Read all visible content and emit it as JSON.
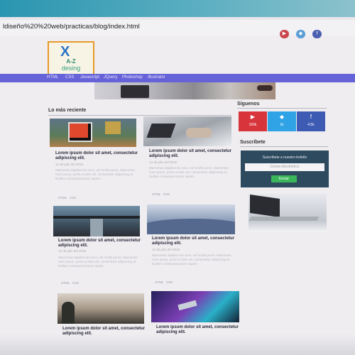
{
  "browser": {
    "url": "ldiseño%20%20web/practicas/blog/index.html"
  },
  "logo": {
    "letter": "X",
    "line1": "A-Z",
    "line2": "desing"
  },
  "top_social": [
    {
      "icon": "youtube-icon",
      "glyph": "▶"
    },
    {
      "icon": "twitter-icon",
      "glyph": "◆"
    },
    {
      "icon": "facebook-icon",
      "glyph": "f"
    }
  ],
  "nav": {
    "items": [
      "HTML",
      "CSS",
      "Javascript",
      "JQuery",
      "Photoshop",
      "Illustrator"
    ]
  },
  "main": {
    "title": "Lo más reciente",
    "posts": [
      {
        "title": "Lorem ipsum dolor sit amet, consectetur adipiscing elit.",
        "date": "12 de julio del 2018",
        "excerpt": "Maecenas dapibus leo arcu, vel mollis purus. Maecenas nunc purus, porta ut ante vel, consectetur adipiscing at Nullam consequat ipsum sapien.",
        "tags": [
          "HTML",
          "CSS"
        ]
      },
      {
        "title": "Lorem ipsum dolor sit amet, consectetur adipiscing elit.",
        "date": "12 de julio del 2018",
        "excerpt": "Maecenas dapibus leo arcu, vel mollis purus. Maecenas nunc purus, porta ut ante vel, consectetur adipiscing at Nullam consequat ipsum sapien.",
        "tags": [
          "HTML",
          "CSS"
        ]
      },
      {
        "title": "Lorem ipsum dolor sit amet, consectetur adipiscing elit.",
        "date": "12 de julio del 2018",
        "excerpt": "Maecenas dapibus leo arcu, vel mollis purus. Maecenas nunc purus, porta ut ante vel, consectetur adipiscing at Nullam consequat ipsum sapien.",
        "tags": [
          "HTML",
          "CSS"
        ]
      },
      {
        "title": "Lorem ipsum dolor sit amet, consectetur adipiscing elit.",
        "date": "12 de julio del 2018",
        "excerpt": "Maecenas dapibus leo arcu, vel mollis purus. Maecenas nunc purus, porta ut ante vel, consectetur adipiscing at Nullam consequat ipsum sapien.",
        "tags": [
          "HTML",
          "CSS"
        ]
      },
      {
        "title": "Lorem ipsum dolor sit amet, consectetur adipiscing elit.",
        "date": "",
        "excerpt": "",
        "tags": []
      },
      {
        "title": "Lorem ipsum dolor sit amet, consectetur adipiscing elit.",
        "date": "",
        "excerpt": "",
        "tags": []
      }
    ]
  },
  "sidebar": {
    "follow_title": "Síguenos",
    "follow": [
      {
        "icon": "youtube-icon",
        "glyph": "▶",
        "count": "150k",
        "color": "#d8343c"
      },
      {
        "icon": "twitter-icon",
        "glyph": "◆",
        "count": "1k",
        "color": "#2fa3e6"
      },
      {
        "icon": "facebook-icon",
        "glyph": "f",
        "count": "4.5k",
        "color": "#3e5bb3"
      }
    ],
    "subscribe_title": "Suscríbete",
    "subscribe": {
      "text": "Suscríbete a nuestro boletín",
      "placeholder": "Correo Electrónico",
      "button": "Enviar"
    }
  },
  "colors": {
    "nav": "#6662d8",
    "subscribe_bg": "#2e4a5e",
    "button": "#3bb55a",
    "logo_border": "#e89a2a"
  }
}
